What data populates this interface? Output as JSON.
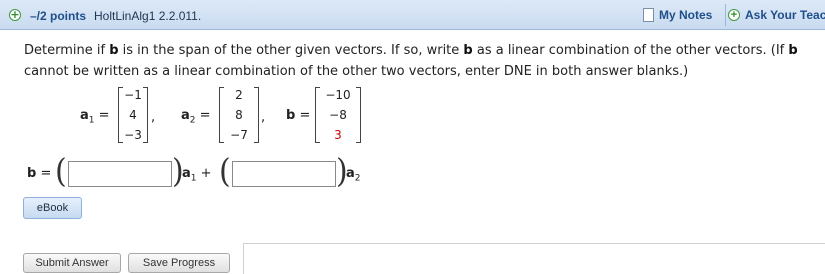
{
  "header": {
    "points": "–/2 points",
    "assignment": "HoltLinAlg1 2.2.011.",
    "my_notes": "My Notes",
    "ask_teacher": "Ask Your Teacher"
  },
  "question": {
    "part1": "Determine if ",
    "b1": "b",
    "part2": " is in the span of the other given vectors. If so, write ",
    "b2": "b",
    "part3": " as a linear combination of the other vectors. (If ",
    "b3": "b",
    "part4": " cannot be written as a linear combination of the other two vectors, enter DNE in both answer blanks.)"
  },
  "vectors": {
    "a1": {
      "label": "a",
      "sub": "1",
      "entries": [
        "−1",
        "4",
        "−3"
      ]
    },
    "a2": {
      "label": "a",
      "sub": "2",
      "entries": [
        "2",
        "8",
        "−7"
      ]
    },
    "b": {
      "label": "b",
      "entries": [
        "−10",
        "−8",
        "3"
      ],
      "highlight_color": "#cc0000"
    }
  },
  "answer": {
    "b_label": "b",
    "equals": "=",
    "a1_label": "a",
    "a1_sub": "1",
    "plus": "+",
    "a2_label": "a",
    "a2_sub": "2",
    "box1_value": "",
    "box2_value": ""
  },
  "buttons": {
    "ebook": "eBook",
    "submit": "Submit Answer",
    "save": "Save Progress"
  },
  "colors": {
    "header_bg": "#c9dbf0",
    "link": "#1f4f8a",
    "plus_icon": "#2e8b2e"
  }
}
